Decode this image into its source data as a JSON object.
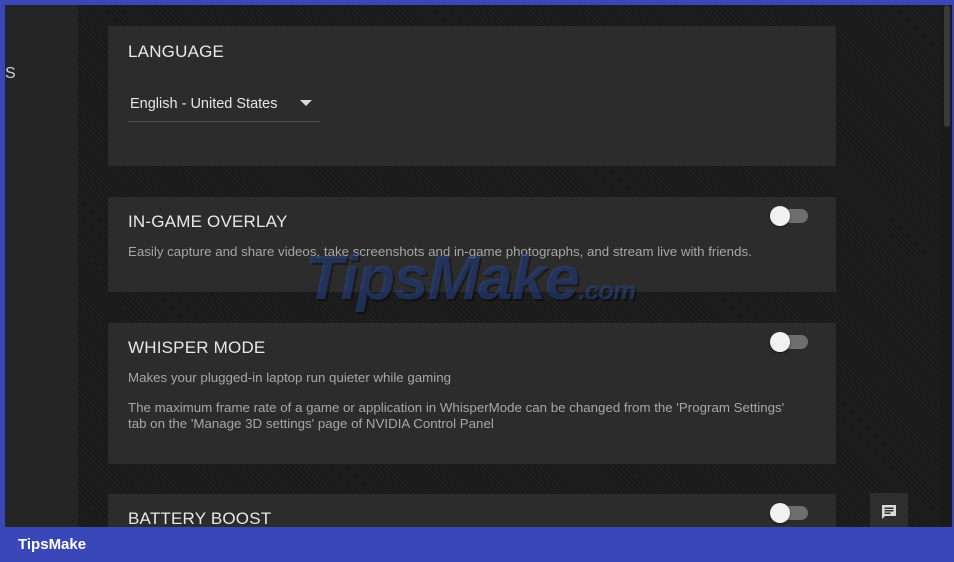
{
  "sidebar": {
    "fragment": "S"
  },
  "language": {
    "title": "LANGUAGE",
    "selected": "English - United States"
  },
  "overlay": {
    "title": "IN-GAME OVERLAY",
    "description": "Easily capture and share videos, take screenshots and in-game photographs, and stream live with friends.",
    "enabled": false
  },
  "whisper": {
    "title": "WHISPER MODE",
    "description": "Makes your plugged-in laptop run quieter while gaming",
    "note_line1": "The maximum frame rate of a game or application in WhisperMode can be changed from the 'Program Settings'",
    "note_line2": "tab on the 'Manage 3D settings' page of NVIDIA Control Panel",
    "enabled": false
  },
  "battery": {
    "title": "BATTERY BOOST",
    "enabled": false
  },
  "chat_icon": "chat-icon",
  "watermark": {
    "main": "TipsMake",
    "suffix": ".com"
  },
  "footer": {
    "brand": "TipsMake"
  },
  "colors": {
    "accent_frame": "#3a47b8",
    "card_bg": "#2c2c2c",
    "toggle_off": "#6e6e6e"
  }
}
